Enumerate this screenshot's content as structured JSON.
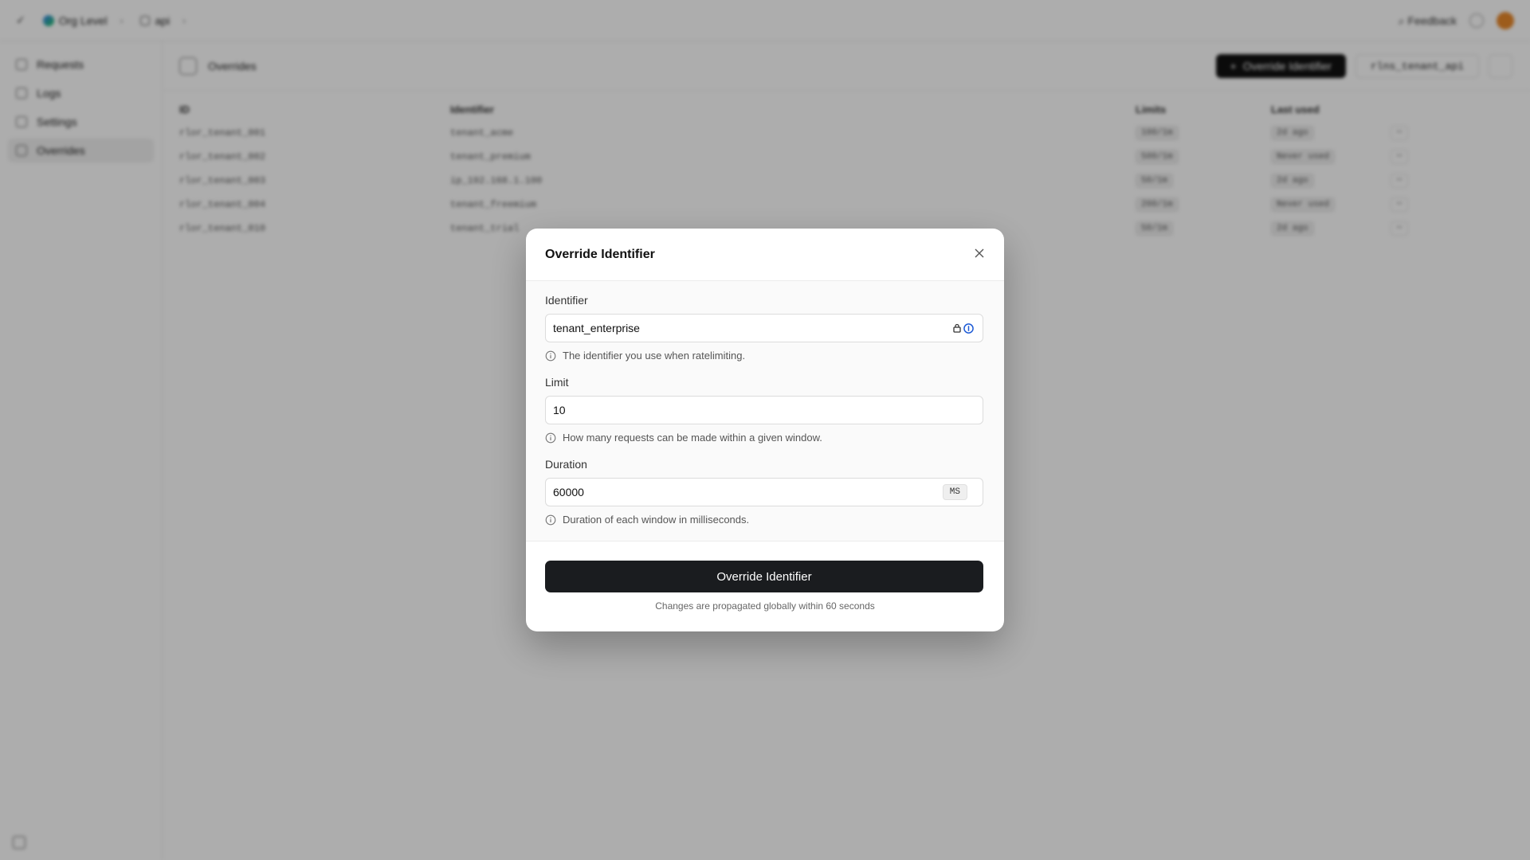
{
  "topbar": {
    "workspace": "Org Level",
    "api_name": "api",
    "feedback": "Feedback"
  },
  "sidebar": {
    "items": [
      {
        "label": "Requests"
      },
      {
        "label": "Logs"
      },
      {
        "label": "Settings"
      },
      {
        "label": "Overrides"
      }
    ]
  },
  "main": {
    "title": "Overrides",
    "override_button": "Override Identifier",
    "namespace": "rlns_tenant_api"
  },
  "table": {
    "headers": [
      "ID",
      "Identifier",
      "Limits",
      "Last used"
    ],
    "rows": [
      {
        "id": "rlor_tenant_001",
        "identifier": "tenant_acme",
        "limit": "100/1m",
        "last_used": "2d ago"
      },
      {
        "id": "rlor_tenant_002",
        "identifier": "tenant_premium",
        "limit": "500/1m",
        "last_used": "Never used"
      },
      {
        "id": "rlor_tenant_003",
        "identifier": "ip_192.168.1.100",
        "limit": "50/1m",
        "last_used": "2d ago"
      },
      {
        "id": "rlor_tenant_004",
        "identifier": "tenant_freemium",
        "limit": "200/1m",
        "last_used": "Never used"
      },
      {
        "id": "rlor_tenant_010",
        "identifier": "tenant_trial",
        "limit": "50/1m",
        "last_used": "2d ago"
      }
    ]
  },
  "dialog": {
    "title": "Override Identifier",
    "identifier_label": "Identifier",
    "identifier_value": "tenant_enterprise",
    "identifier_help": "The identifier you use when ratelimiting.",
    "limit_label": "Limit",
    "limit_value": "10",
    "limit_help": "How many requests can be made within a given window.",
    "duration_label": "Duration",
    "duration_value": "60000",
    "duration_unit": "MS",
    "duration_help": "Duration of each window in milliseconds.",
    "submit_label": "Override Identifier",
    "footer_note": "Changes are propagated globally within 60 seconds"
  }
}
